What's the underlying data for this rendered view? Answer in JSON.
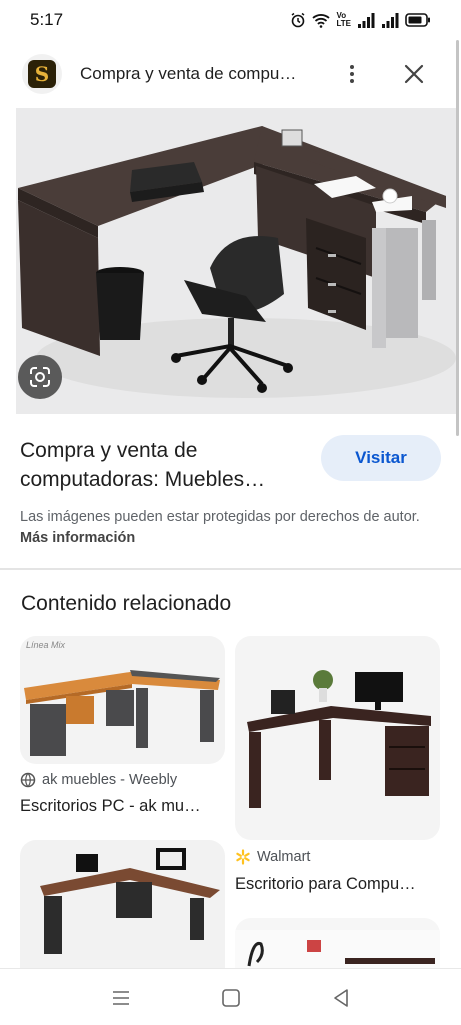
{
  "status_bar": {
    "time": "5:17",
    "volte": "Vo\nLTE"
  },
  "header": {
    "site_title": "Compra y venta de compu…",
    "logo_letter": "S"
  },
  "main": {
    "title": "Compra y venta de computadoras: Muebles…",
    "visit_label": "Visitar",
    "copyright_text": "Las imágenes pueden estar protegidas por derechos de autor.",
    "more_info_label": "Más información"
  },
  "related": {
    "section_title": "Contenido relacionado",
    "cards": [
      {
        "watermark": "Línea Mix",
        "source": "ak muebles - Weebly",
        "title": "Escritorios PC - ak mu…"
      },
      {
        "source": "Walmart",
        "title": "Escritorio para Compu…"
      }
    ]
  },
  "colors": {
    "accent": "#0b57d0",
    "visit_bg": "#e6eef9",
    "walmart": "#ffc220"
  }
}
